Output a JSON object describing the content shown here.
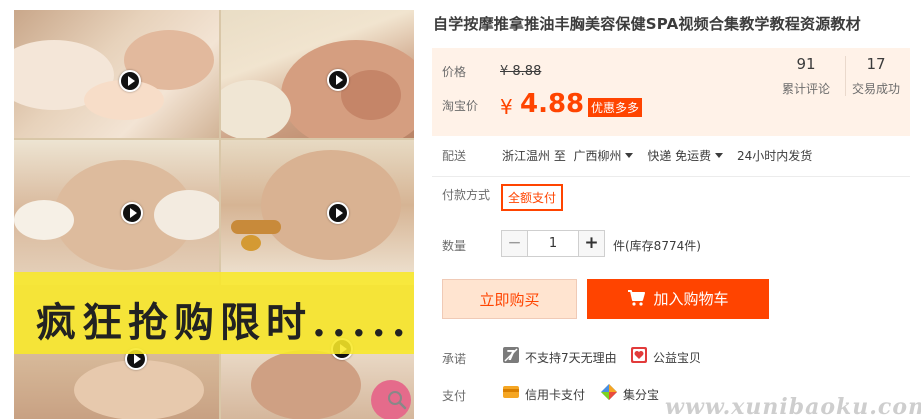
{
  "gallery": {
    "promo_text": "疯狂抢购限时.....",
    "zoom_icon": "magnifier-icon",
    "play_icon": "play-icon"
  },
  "product": {
    "title": "自学按摩推拿推油丰胸美容保健SPA视频合集教学教程资源教材"
  },
  "price": {
    "price_label": "价格",
    "original": "¥ 8.88",
    "taobao_label": "淘宝价",
    "currency": "¥",
    "sale": "4.88",
    "promo_tag": "优惠多多"
  },
  "stats": {
    "reviews_count": "91",
    "reviews_label": "累计评论",
    "trades_count": "17",
    "trades_label": "交易成功"
  },
  "shipping": {
    "label": "配送",
    "from": "浙江温州 至",
    "to": "广西柳州",
    "method": "快递 免运费",
    "dispatch": "24小时内发货"
  },
  "payment": {
    "label": "付款方式",
    "option": "全额支付"
  },
  "quantity": {
    "label": "数量",
    "value": "1",
    "minus": "−",
    "plus": "+",
    "stock": "件(库存8774件)"
  },
  "actions": {
    "buy_now": "立即购买",
    "add_to_cart": "加入购物车"
  },
  "promise": {
    "label": "承诺",
    "no_return": "不支持7天无理由",
    "charity": "公益宝贝"
  },
  "pay_methods": {
    "label": "支付",
    "credit_card": "信用卡支付",
    "jifenbao": "集分宝"
  },
  "watermark": "www.xunibaoku.com",
  "colors": {
    "accent": "#ff4400",
    "price_bg": "#fff2e8",
    "buy_bg": "#ffe4d0"
  }
}
